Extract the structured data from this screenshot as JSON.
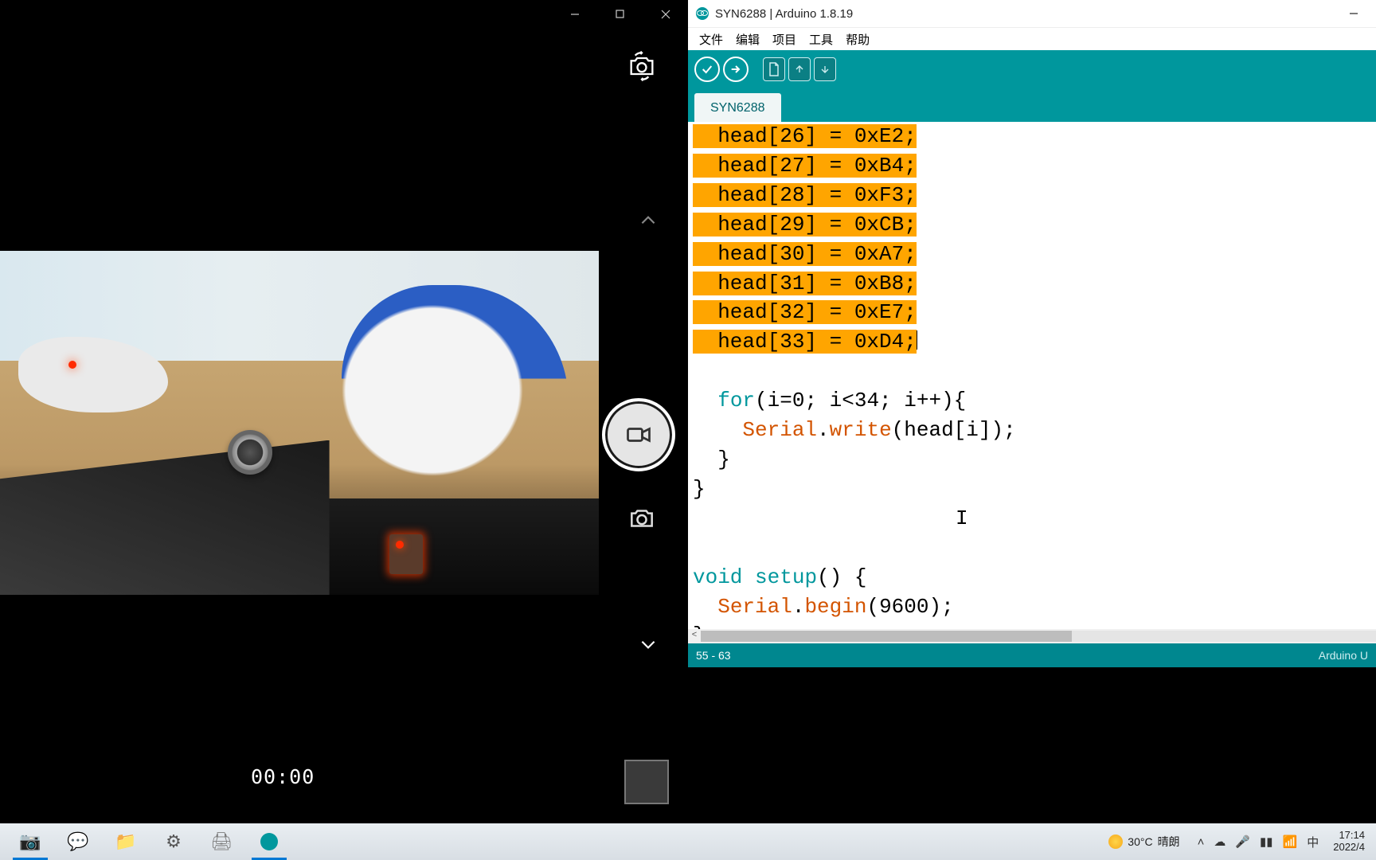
{
  "camera": {
    "minimize_tip": "Minimize",
    "maximize_tip": "Maximize",
    "close_tip": "Close",
    "rec_time": "00:00"
  },
  "arduino": {
    "title": "SYN6288 | Arduino 1.8.19",
    "menu": [
      "文件",
      "编辑",
      "项目",
      "工具",
      "帮助"
    ],
    "tab": "SYN6288",
    "code": {
      "highlighted": [
        "  head[26] = 0xE2;",
        "  head[27] = 0xB4;",
        "  head[28] = 0xF3;",
        "  head[29] = 0xCB;",
        "  head[30] = 0xA7;",
        "  head[31] = 0xB8;",
        "  head[32] = 0xE7;",
        "  head[33] = 0xD4;"
      ],
      "for_kw": "for",
      "for_rest": "(i=0; i<34; i++){",
      "serial": "Serial",
      "dot_write": ".",
      "write": "write",
      "write_args": "(head[i]);",
      "brace1": "  }",
      "brace2": "}",
      "void": "void",
      "setup": "setup",
      "setup_rest": "() {",
      "serial2": "Serial",
      "dot2": ".",
      "begin": "begin",
      "begin_args": "(9600);",
      "brace3": "}"
    },
    "status_left": "55 - 63",
    "status_right": "Arduino U"
  },
  "taskbar": {
    "weather_temp": "30°C",
    "weather_cond": "晴朗",
    "ime": "中",
    "time": "17:14",
    "date": "2022/4"
  }
}
